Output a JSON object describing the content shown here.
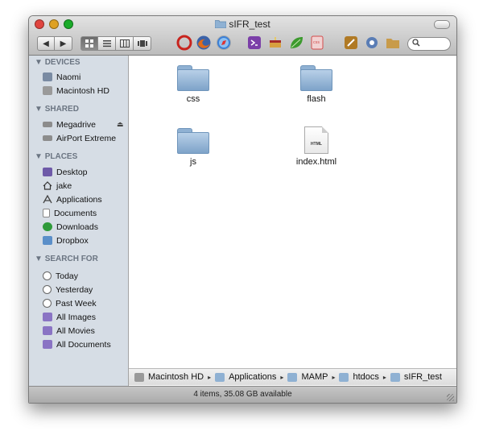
{
  "window": {
    "title": "sIFR_test",
    "colors": {
      "close": "#e0443e",
      "minimize": "#dea123",
      "zoom": "#1aab29",
      "sidebar": "#d6dde5",
      "folder": "#8fb1d3"
    }
  },
  "toolbar": {
    "back_icon": "◀",
    "forward_icon": "▶",
    "view_modes": [
      "icon-view",
      "list-view",
      "column-view",
      "coverflow-view"
    ],
    "apps": [
      {
        "name": "unison-app-icon",
        "color": "#c8241e"
      },
      {
        "name": "firefox-icon",
        "color": "#e06b1c"
      },
      {
        "name": "safari-icon",
        "color": "#3b7fd6"
      },
      {
        "name": "textmate-icon",
        "color": "#7b3fa8"
      },
      {
        "name": "cake-app-icon",
        "color": "#d7a040"
      },
      {
        "name": "leaf-app-icon",
        "color": "#3c9a2e"
      },
      {
        "name": "css-edit-icon",
        "color": "#d24c4c"
      },
      {
        "name": "coda-app-icon",
        "color": "#b07a25"
      },
      {
        "name": "network-app-icon",
        "color": "#5a7db5"
      },
      {
        "name": "folder-app-icon",
        "color": "#c89b4a"
      }
    ],
    "search_glyph": "🔍"
  },
  "sidebar": {
    "devices": {
      "header": "DEVICES",
      "items": [
        {
          "label": "Naomi",
          "icon": "laptop-icon"
        },
        {
          "label": "Macintosh HD",
          "icon": "hard-drive-icon"
        }
      ]
    },
    "shared": {
      "header": "SHARED",
      "items": [
        {
          "label": "Megadrive",
          "icon": "network-drive-icon"
        },
        {
          "label": "AirPort Extreme",
          "icon": "network-drive-icon"
        }
      ],
      "eject": "⏏"
    },
    "places": {
      "header": "PLACES",
      "items": [
        {
          "label": "Desktop",
          "icon": "desktop-icon"
        },
        {
          "label": "jake",
          "icon": "home-icon"
        },
        {
          "label": "Applications",
          "icon": "applications-icon"
        },
        {
          "label": "Documents",
          "icon": "documents-icon"
        },
        {
          "label": "Downloads",
          "icon": "downloads-icon"
        },
        {
          "label": "Dropbox",
          "icon": "dropbox-icon"
        }
      ]
    },
    "search": {
      "header": "SEARCH FOR",
      "items": [
        {
          "label": "Today",
          "icon": "clock-icon"
        },
        {
          "label": "Yesterday",
          "icon": "clock-icon"
        },
        {
          "label": "Past Week",
          "icon": "clock-icon"
        },
        {
          "label": "All Images",
          "icon": "smart-folder-icon"
        },
        {
          "label": "All Movies",
          "icon": "smart-folder-icon"
        },
        {
          "label": "All Documents",
          "icon": "smart-folder-icon"
        }
      ]
    },
    "disclosure": "▼"
  },
  "files": [
    {
      "name": "css",
      "kind": "folder"
    },
    {
      "name": "flash",
      "kind": "folder"
    },
    {
      "name": "js",
      "kind": "folder"
    },
    {
      "name": "index.html",
      "kind": "html",
      "badge": "HTML"
    }
  ],
  "path_bar": {
    "items": [
      "Macintosh HD",
      "Applications",
      "MAMP",
      "htdocs",
      "sIFR_test"
    ],
    "separator": "▸"
  },
  "status": {
    "text": "4 items, 35.08 GB available"
  }
}
